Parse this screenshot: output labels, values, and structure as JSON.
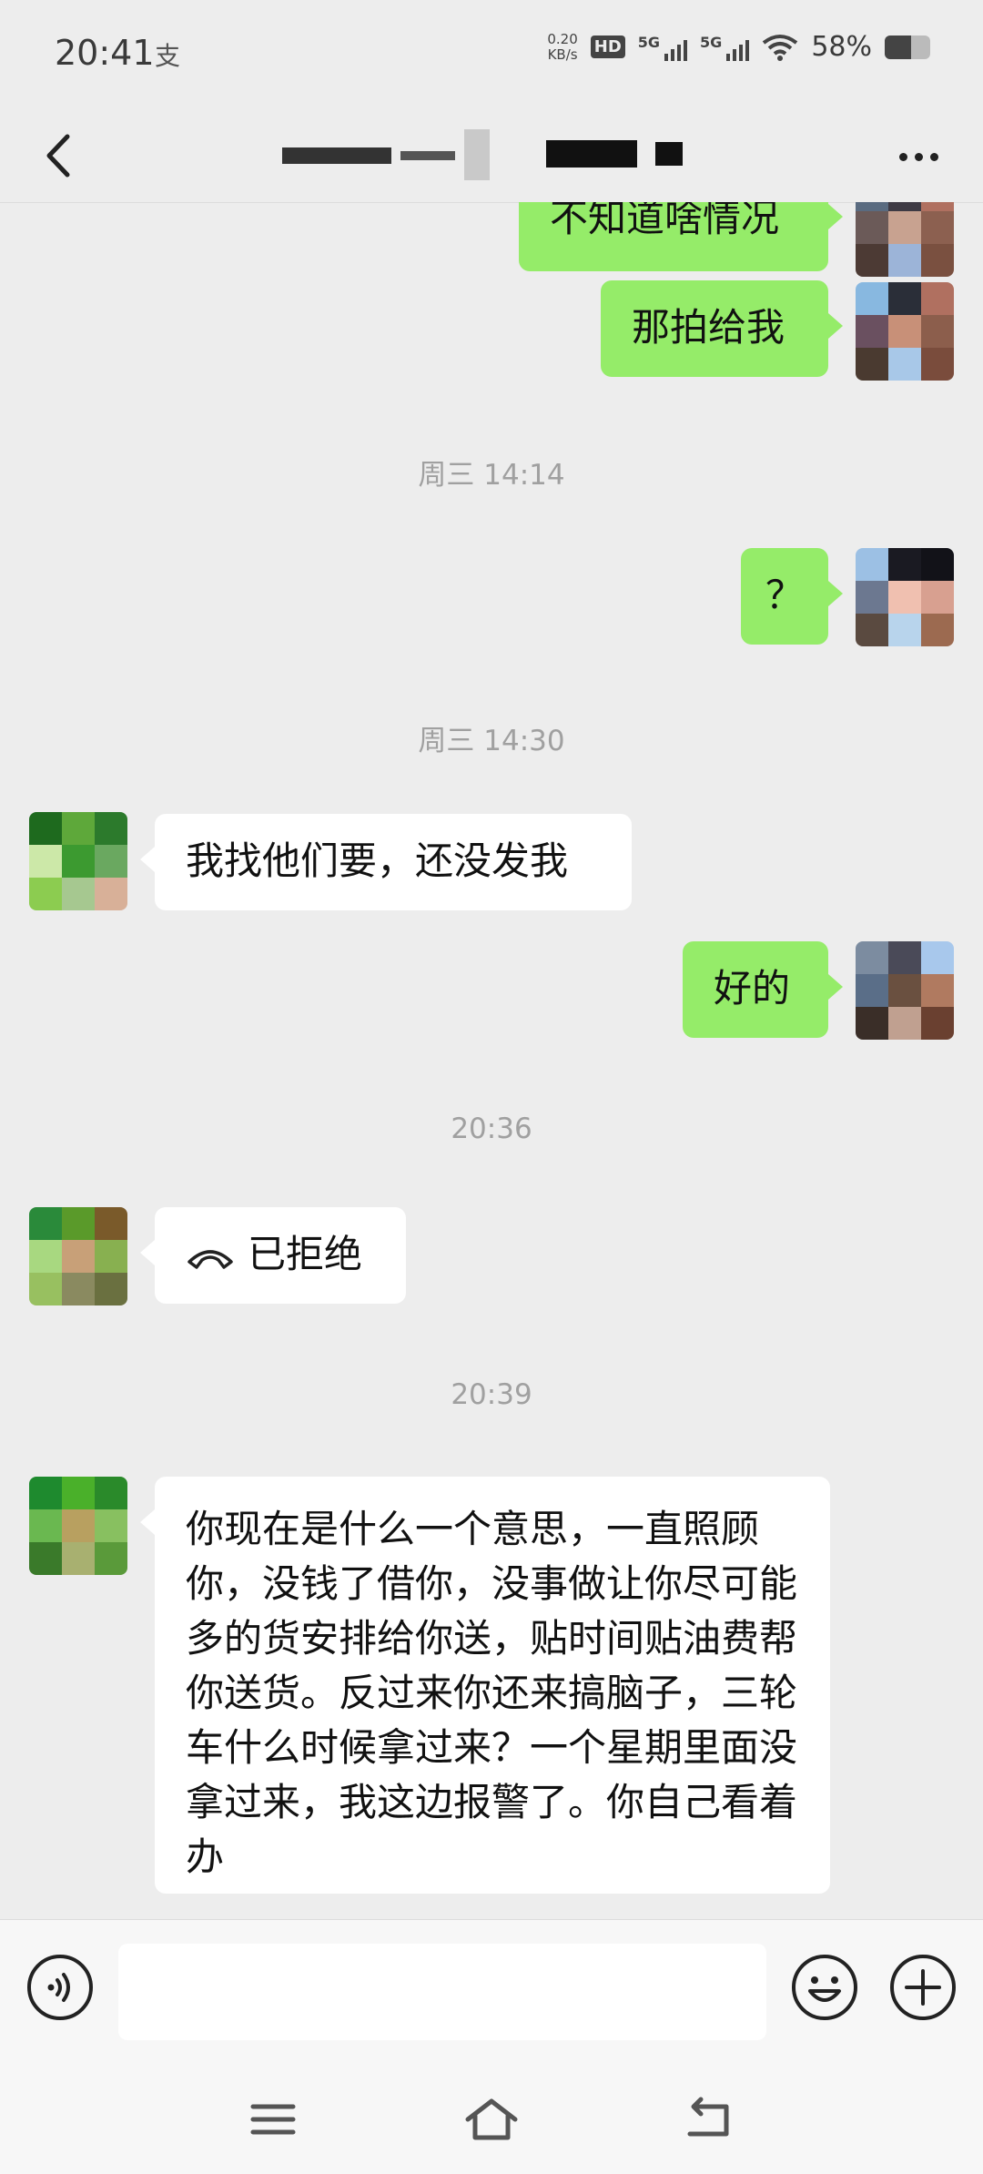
{
  "status_bar": {
    "time": "20:41",
    "app_icon_glyph": "支",
    "net_speed_value": "0.20",
    "net_speed_unit": "KB/s",
    "hd_label": "HD",
    "signal_1_label": "5G",
    "signal_2_label": "5G",
    "battery_percent": "58%",
    "battery_level": 0.58
  },
  "title_bar": {
    "back_icon": "chevron-left-icon",
    "title_visible_fragment": "",
    "more_icon": "more-horizontal-icon"
  },
  "messages": [
    {
      "side": "out",
      "text": "不知道啥情况"
    },
    {
      "side": "out",
      "text": "那拍给我"
    },
    {
      "type": "time",
      "text": "周三 14:14"
    },
    {
      "side": "out",
      "text": "？"
    },
    {
      "type": "time",
      "text": "周三 14:30"
    },
    {
      "side": "in",
      "text": "我找他们要，还没发我"
    },
    {
      "side": "out",
      "text": "好的"
    },
    {
      "type": "time",
      "text": "20:36"
    },
    {
      "side": "in",
      "text": "已拒绝",
      "icon": "phone-hangup-icon"
    },
    {
      "type": "time",
      "text": "20:39"
    },
    {
      "side": "in",
      "text": "你现在是什么一个意思，一直照顾你，没钱了借你，没事做让你尽可能多的货安排给你送，贴时间贴油费帮你送货。反过来你还来搞脑子，三轮车什么时候拿过来？一个星期里面没拿过来，我这边报警了。你自己看着办"
    }
  ],
  "input_bar": {
    "voice_icon": "voice-icon",
    "input_value": "",
    "emoji_icon": "emoji-icon",
    "plus_icon": "plus-circle-icon"
  },
  "nav_bar": {
    "menu_icon": "menu-icon",
    "home_icon": "home-icon",
    "back_icon": "back-icon"
  },
  "colors": {
    "background": "#ededed",
    "outgoing_bubble": "#95ec69",
    "incoming_bubble": "#ffffff",
    "timestamp_text": "#a0a0a0"
  }
}
